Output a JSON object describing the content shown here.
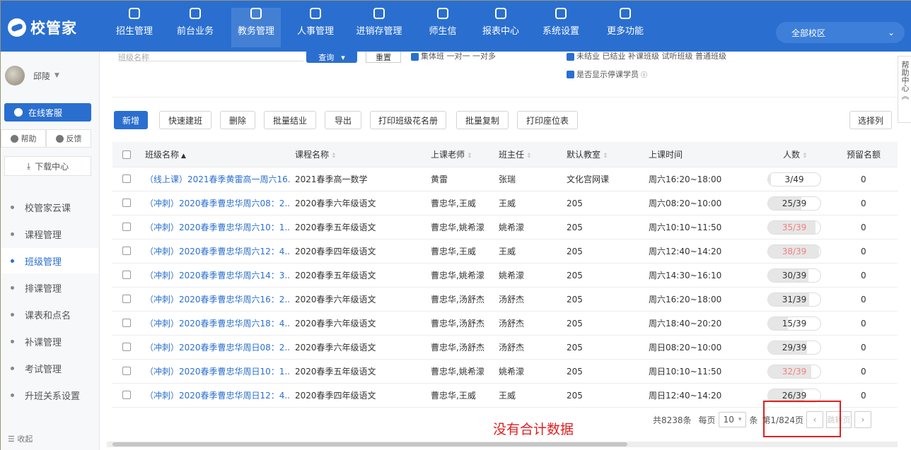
{
  "app": {
    "logo_text": "校管家"
  },
  "nav": {
    "items": [
      {
        "label": "招生管理",
        "icon": "user-add-icon"
      },
      {
        "label": "前台业务",
        "icon": "desk-icon"
      },
      {
        "label": "教务管理",
        "icon": "book-icon"
      },
      {
        "label": "人事管理",
        "icon": "person-icon"
      },
      {
        "label": "进销存管理",
        "icon": "inventory-icon"
      },
      {
        "label": "师生信",
        "icon": "message-icon"
      },
      {
        "label": "报表中心",
        "icon": "chart-icon"
      },
      {
        "label": "系统设置",
        "icon": "gear-icon"
      },
      {
        "label": "更多功能",
        "icon": "more-icon"
      }
    ],
    "active_index": 2,
    "campus": "全部校区"
  },
  "sidebar": {
    "user_name": "邱陵",
    "online_service": "在线客服",
    "help": "帮助",
    "feedback": "反馈",
    "download": "下载中心",
    "menu": [
      {
        "label": "校管家云课"
      },
      {
        "label": "课程管理"
      },
      {
        "label": "班级管理"
      },
      {
        "label": "排课管理"
      },
      {
        "label": "课表和点名"
      },
      {
        "label": "补课管理"
      },
      {
        "label": "考试管理"
      },
      {
        "label": "升班关系设置"
      }
    ],
    "active_menu": "班级管理",
    "collapse": "收起"
  },
  "filters": {
    "search_placeholder": "班级名称",
    "query": "查询",
    "reset": "重置",
    "type_checks": "集体班  一对一  一对多",
    "status_checks": "未结业  已结业  补课班级  试听班级  普通班级",
    "show_stopped": "是否显示停课学员"
  },
  "toolbar": {
    "add": "新增",
    "quick": "快速建班",
    "delete": "删除",
    "batch_finish": "批量结业",
    "export": "导出",
    "print_roster": "打印班级花名册",
    "batch_copy": "批量复制",
    "print_seat": "打印座位表",
    "choose_cols": "选择列"
  },
  "help_side": "帮助中心《",
  "table": {
    "headers": {
      "name": "班级名称",
      "course": "课程名称",
      "teacher": "上课老师",
      "head": "班主任",
      "room": "默认教室",
      "time": "上课时间",
      "count": "人数",
      "reserve": "预留名额"
    },
    "rows": [
      {
        "name": "（线上课）2021春季黄雷高一周六16...",
        "course": "2021春季高一数学",
        "teacher": "黄雷",
        "head": "张瑞",
        "room": "文化宫网课",
        "time": "周六16:20~18:00",
        "count": "3/49",
        "fill": 0.06,
        "full": false,
        "reserve": "0"
      },
      {
        "name": "（冲刺）2020春季曹忠华周六08：2...",
        "course": "2020春季六年级语文",
        "teacher": "曹忠华,王威",
        "head": "王威",
        "room": "205",
        "time": "周六08:20~10:00",
        "count": "25/39",
        "fill": 0.64,
        "full": false,
        "reserve": "0"
      },
      {
        "name": "（冲刺）2020春季曹忠华周六10：1...",
        "course": "2020春季五年级语文",
        "teacher": "曹忠华,姚希濛",
        "head": "姚希濛",
        "room": "205",
        "time": "周六10:10~11:50",
        "count": "35/39",
        "fill": 0.9,
        "full": true,
        "reserve": "0"
      },
      {
        "name": "（冲刺）2020春季曹忠华周六12：4...",
        "course": "2020春季四年级语文",
        "teacher": "曹忠华,王威",
        "head": "王威",
        "room": "205",
        "time": "周六12:40~14:20",
        "count": "38/39",
        "fill": 0.97,
        "full": true,
        "reserve": "0"
      },
      {
        "name": "（冲刺）2020春季曹忠华周六14：3...",
        "course": "2020春季五年级语文",
        "teacher": "曹忠华,姚希濛",
        "head": "姚希濛",
        "room": "205",
        "time": "周六14:30~16:10",
        "count": "30/39",
        "fill": 0.77,
        "full": false,
        "reserve": "0"
      },
      {
        "name": "（冲刺）2020春季曹忠华周六16：2...",
        "course": "2020春季六年级语文",
        "teacher": "曹忠华,汤舒杰",
        "head": "汤舒杰",
        "room": "205",
        "time": "周六16:20~18:00",
        "count": "31/39",
        "fill": 0.79,
        "full": false,
        "reserve": "0"
      },
      {
        "name": "（冲刺）2020春季曹忠华周六18：4...",
        "course": "2020春季六年级语文",
        "teacher": "曹忠华,汤舒杰",
        "head": "汤舒杰",
        "room": "205",
        "time": "周六18:40~20:20",
        "count": "15/39",
        "fill": 0.38,
        "full": false,
        "reserve": "0"
      },
      {
        "name": "（冲刺）2020春季曹忠华周日08：2...",
        "course": "2020春季六年级语文",
        "teacher": "曹忠华,汤舒杰",
        "head": "汤舒杰",
        "room": "205",
        "time": "周日08:20~10:00",
        "count": "29/39",
        "fill": 0.74,
        "full": false,
        "reserve": "0"
      },
      {
        "name": "（冲刺）2020春季曹忠华周日10：1...",
        "course": "2020春季五年级语文",
        "teacher": "曹忠华,姚希濛",
        "head": "姚希濛",
        "room": "205",
        "time": "周日10:10~11:50",
        "count": "32/39",
        "fill": 0.82,
        "full": true,
        "reserve": "0"
      },
      {
        "name": "（冲刺）2020春季曹忠华周日12：4...",
        "course": "2020春季四年级语文",
        "teacher": "曹忠华,王威",
        "head": "王威",
        "room": "205",
        "time": "周日12:40~14:20",
        "count": "26/39",
        "fill": 0.67,
        "full": false,
        "reserve": "0"
      }
    ]
  },
  "pager": {
    "total": "共8238条",
    "per_page": "每页",
    "per_value": "10",
    "unit": "条",
    "page": "第1/824页",
    "jump": "跳转页"
  },
  "annotation": "没有合计数据",
  "colors": {
    "brand": "#2a6fcf",
    "highlight": "#e02020"
  }
}
